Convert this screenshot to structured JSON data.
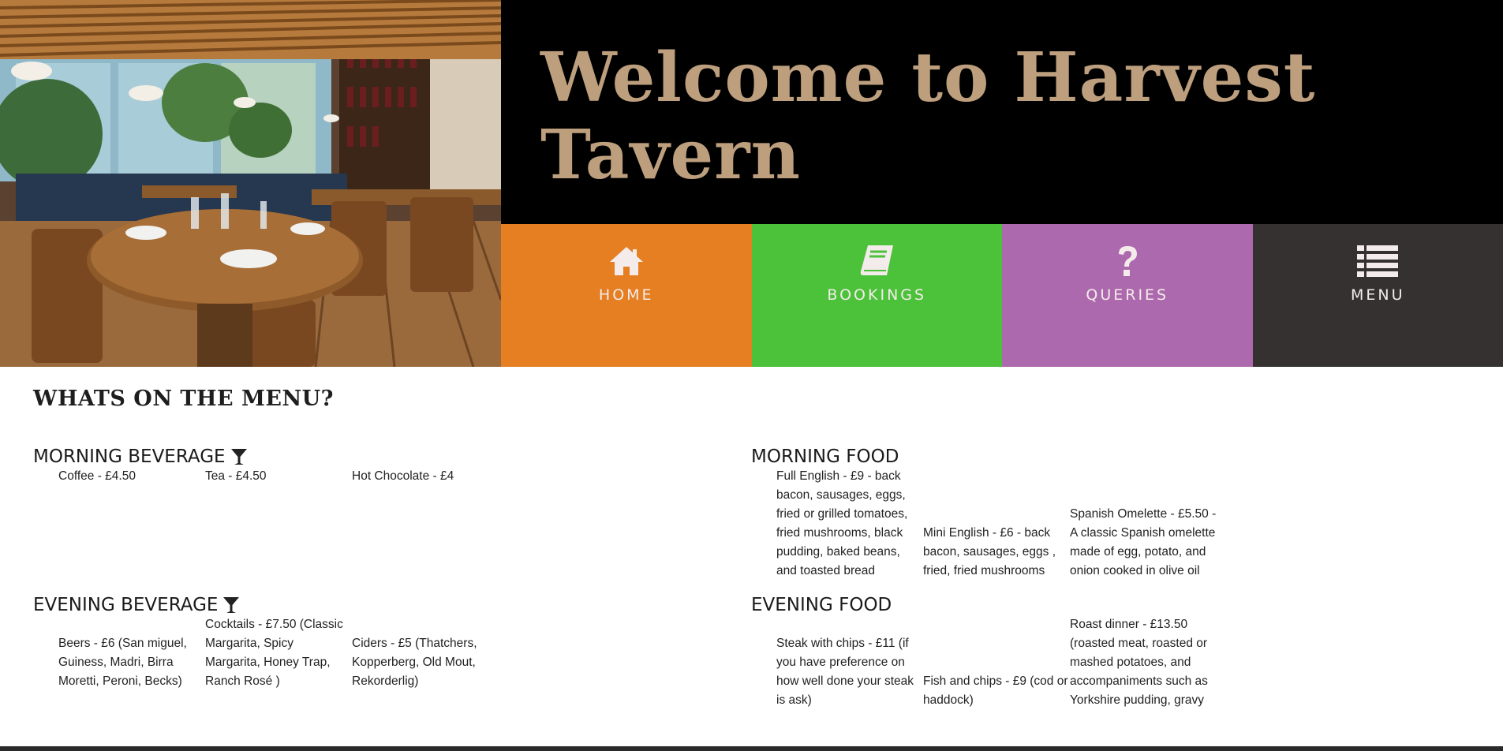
{
  "header": {
    "title": "Welcome to Harvest Tavern"
  },
  "nav": {
    "items": [
      {
        "label": "HOME",
        "icon": "home-icon",
        "color": "#e67e22"
      },
      {
        "label": "BOOKINGS",
        "icon": "book-icon",
        "color": "#4cc13a"
      },
      {
        "label": "QUERIES",
        "icon": "question-icon",
        "color": "#ad69ad"
      },
      {
        "label": "MENU",
        "icon": "list-icon",
        "color": "#353131"
      }
    ]
  },
  "menu": {
    "heading": "WHATS ON THE MENU?",
    "morning_beverage": {
      "title": "MORNING BEVERAGE",
      "icon": "cocktail-glass-icon",
      "items": [
        "Coffee - £4.50",
        "Tea - £4.50",
        "Hot Chocolate - £4"
      ]
    },
    "evening_beverage": {
      "title": "EVENING BEVERAGE",
      "icon": "cocktail-glass-icon",
      "items": [
        "Beers - £6 (San miguel, Guiness, Madri, Birra Moretti, Peroni, Becks)",
        "Cocktails - £7.50 (Classic Margarita, Spicy Margarita, Honey Trap, Ranch Rosé )",
        "Ciders - £5 (Thatchers, Kopperberg, Old Mout, Rekorderlig)"
      ]
    },
    "morning_food": {
      "title": "MORNING FOOD",
      "items": [
        "Full English - £9 - back bacon, sausages, eggs, fried or grilled tomatoes, fried mushrooms, black pudding, baked beans, and toasted bread",
        "Mini English - £6 - back bacon, sausages, eggs , fried, fried mushrooms",
        "Spanish Omelette - £5.50 - A classic Spanish omelette made of egg, potato, and onion cooked in olive oil"
      ]
    },
    "evening_food": {
      "title": "EVENING FOOD",
      "items": [
        "Steak with chips - £11 (if you have preference on how well done your steak is ask)",
        "Fish and chips - £9 (cod or haddock)",
        "Roast dinner - £13.50 (roasted meat, roasted or mashed potatoes, and accompaniments such as Yorkshire pudding, gravy"
      ]
    }
  }
}
